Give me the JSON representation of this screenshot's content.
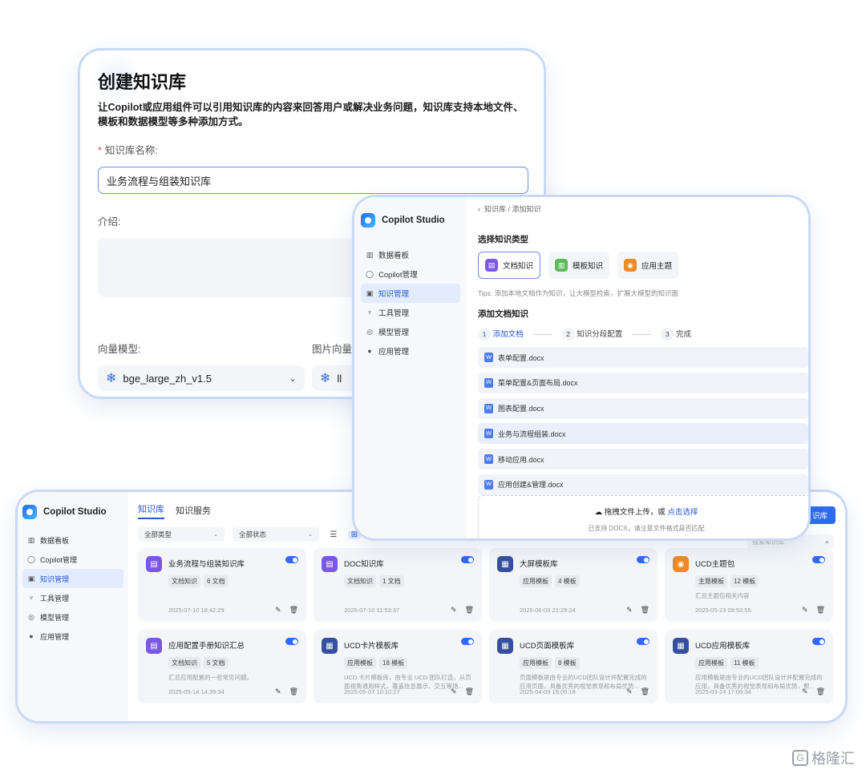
{
  "create": {
    "title": "创建知识库",
    "description": "让Copilot或应用组件可以引用知识库的内容来回答用户或解决业务问题，知识库支持本地文件、模板和数据模型等多种添加方式。",
    "name_label": "知识库名称:",
    "name_value": "业务流程与组装知识库",
    "intro_label": "介绍:",
    "vector_label": "向量模型:",
    "vector_value": "bge_large_zh_v1.5",
    "image_vector_label": "图片向量",
    "image_vector_value": "ll"
  },
  "app": {
    "name": "Copilot Studio",
    "nav": [
      {
        "label": "数据看板",
        "icon": "chart-icon"
      },
      {
        "label": "Copilot管理",
        "icon": "chat-icon"
      },
      {
        "label": "知识管理",
        "icon": "book-icon",
        "active": true
      },
      {
        "label": "工具管理",
        "icon": "tool-icon"
      },
      {
        "label": "模型管理",
        "icon": "model-icon"
      },
      {
        "label": "应用管理",
        "icon": "app-icon"
      }
    ]
  },
  "add": {
    "breadcrumb": "知识库 / 添加知识",
    "select_type_title": "选择知识类型",
    "types": [
      {
        "label": "文档知识",
        "color": "#7b57e6"
      },
      {
        "label": "模板知识",
        "color": "#5db85b"
      },
      {
        "label": "应用主题",
        "color": "#f08a24"
      }
    ],
    "tips": "Tips: 添加本地文档作为知识，让大模型检索，扩展大模型的知识面",
    "add_doc_title": "添加文档知识",
    "steps": [
      {
        "num": "1",
        "label": "添加文档"
      },
      {
        "num": "2",
        "label": "知识分段配置"
      },
      {
        "num": "3",
        "label": "完成"
      }
    ],
    "files": [
      "表单配置.docx",
      "菜单配置&页面布局.docx",
      "图表配置.docx",
      "业务与流程组装.docx",
      "移动应用.docx",
      "应用创建&管理.docx"
    ],
    "drop_text": "拖拽文件上传，或",
    "drop_link": "点击选择",
    "drop_hint": "已支持 DOCX，请注意文件格式是否匹配"
  },
  "list": {
    "tabs": [
      "知识库",
      "知识服务"
    ],
    "filter_type": "全部类型",
    "filter_status": "全部状态",
    "create_button": "识库",
    "search_placeholder": "搜索知识库",
    "cards": [
      {
        "name": "业务流程与组装知识库",
        "tag": "文档知识",
        "count": "6 文档",
        "desc": "",
        "date": "2025-07-10 18:42:29",
        "color": "#7b57e6",
        "icon": "doc-icon"
      },
      {
        "name": "DOC知识库",
        "tag": "文档知识",
        "count": "1 文档",
        "desc": "",
        "date": "2025-07-10 11:53:37",
        "color": "#7b57e6",
        "icon": "doc-icon"
      },
      {
        "name": "大屏模板库",
        "tag": "应用模板",
        "count": "4 模板",
        "desc": "",
        "date": "2025-06-05 21:29:24",
        "color": "#35509e",
        "icon": "template-icon"
      },
      {
        "name": "UCD主题包",
        "tag": "主题模板",
        "count": "12 模板",
        "desc": "汇总主题包相关内容",
        "date": "2025-05-23 09:53:55",
        "color": "#f08a24",
        "icon": "palette-icon"
      },
      {
        "name": "应用配置手册知识汇总",
        "tag": "文档知识",
        "count": "5 文档",
        "desc": "汇总应用配置的一些常见问题。",
        "date": "2025-05-14 14:39:34",
        "color": "#7b57e6",
        "icon": "doc-icon"
      },
      {
        "name": "UCD卡片模板库",
        "tag": "应用模板",
        "count": "18 模板",
        "desc": "UCD 卡片模板库，由专业 UCD 团队打造，从页面视角通用样式，覆盖信息展示、交互等场...",
        "date": "2025-05-07 10:10:27",
        "color": "#35509e",
        "icon": "template-icon"
      },
      {
        "name": "UCD页面模板库",
        "tag": "应用模板",
        "count": "8 模板",
        "desc": "页面模板是由专业的UCD团队设计并配置完成的应用页面，具备优秀的视觉表现和布局优势...",
        "date": "2025-04-09 15:09:18",
        "color": "#35509e",
        "icon": "template-icon"
      },
      {
        "name": "UCD应用模板库",
        "tag": "应用模板",
        "count": "11 模板",
        "desc": "应用模板是由专业的UCD团队设计并配置完成的应用，具备优秀的视觉表现和布局优势，帮...",
        "date": "2025-03-24 17:09:34",
        "color": "#35509e",
        "icon": "template-icon"
      }
    ]
  },
  "watermark": "格隆汇"
}
